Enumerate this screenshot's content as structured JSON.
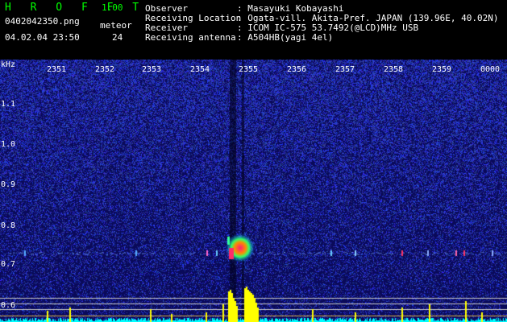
{
  "header": {
    "app_name": "H R O F F T",
    "version": "1.00",
    "filename": "0402042350.png",
    "datetime": "04.02.04 23:50",
    "meteor_label": "meteor",
    "meteor_count": "24",
    "observer_label": "Observer",
    "observer_value": ": Masayuki Kobayashi",
    "location_label": "Receiving Location",
    "location_value": ": Ogata-vill. Akita-Pref. JAPAN (139.96E, 40.02N)",
    "receiver_label": "Receiver",
    "receiver_value": ": ICOM IC-575 53.7492(@LCD)MHz USB",
    "antenna_label": "Receiving antenna",
    "antenna_value": ": A504HB(yagi 4el)"
  },
  "spectrogram": {
    "y_unit": "kHz",
    "y_ticks": [
      "1.1",
      "1.0",
      "0.9",
      "0.8",
      "0.7",
      "0.6"
    ],
    "x_ticks": [
      "2351",
      "2352",
      "2353",
      "2354",
      "2355",
      "2356",
      "2357",
      "2358",
      "2359",
      "0000"
    ],
    "background_color": "#0a0a5a",
    "noise_color": "#2a3cc8",
    "signal_band_khz": 0.73,
    "histogram_color": "#ffff00",
    "baseline_color": "#00ffff"
  }
}
